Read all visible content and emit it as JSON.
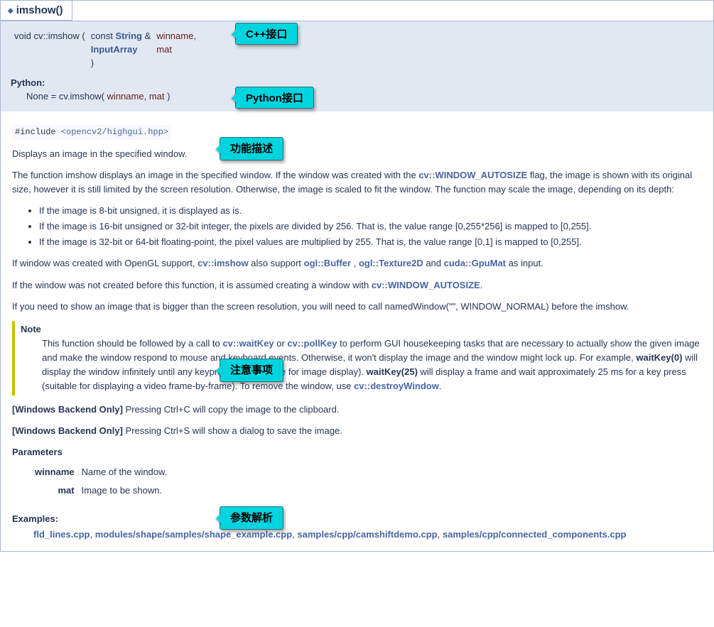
{
  "header": {
    "title": "imshow()"
  },
  "callouts": {
    "cpp": "C++接口",
    "python": "Python接口",
    "desc": "功能描述",
    "note": "注意事项",
    "params": "参数解析"
  },
  "sig": {
    "ret": "void",
    "ns": "cv::imshow",
    "open": "(",
    "row1_type_pre": "const ",
    "row1_type_link": "String",
    "row1_type_post": " & ",
    "row1_name": "winname",
    "row1_end": ",",
    "row2_type": "InputArray",
    "row2_name": "mat",
    "close": ")"
  },
  "python": {
    "label": "Python:",
    "pre": "None = cv.imshow( ",
    "p1": "winname",
    "mid": ", ",
    "p2": "mat",
    "post": " )"
  },
  "include": {
    "pre": "#include ",
    "path": "<opencv2/highgui.hpp>"
  },
  "brief": "Displays an image in the specified window.",
  "para1_a": "The function imshow displays an image in the specified window. If the window was created with the ",
  "para1_link": "cv::WINDOW_AUTOSIZE",
  "para1_b": " flag, the image is shown with its original size, however it is still limited by the screen resolution. Otherwise, the image is scaled to fit the window. The function may scale the image, depending on its depth:",
  "bullets": [
    "If the image is 8-bit unsigned, it is displayed as is.",
    "If the image is 16-bit unsigned or 32-bit integer, the pixels are divided by 256. That is, the value range [0,255*256] is mapped to [0,255].",
    "If the image is 32-bit or 64-bit floating-point, the pixel values are multiplied by 255. That is, the value range [0,1] is mapped to [0,255]."
  ],
  "opengl": {
    "a": "If window was created with OpenGL support, ",
    "l1": "cv::imshow",
    "b": " also support ",
    "l2": "ogl::Buffer",
    "c": " , ",
    "l3": "ogl::Texture2D",
    "d": " and ",
    "l4": "cuda::GpuMat",
    "e": " as input."
  },
  "notcreated": {
    "a": "If the window was not created before this function, it is assumed creating a window with ",
    "l": "cv::WINDOW_AUTOSIZE",
    "b": "."
  },
  "bigger": "If you need to show an image that is bigger than the screen resolution, you will need to call namedWindow(\"\", WINDOW_NORMAL) before the imshow.",
  "note": {
    "title": "Note",
    "a": "This function should be followed by a call to ",
    "l1": "cv::waitKey",
    "b": " or ",
    "l2": "cv::pollKey",
    "c": " to perform GUI housekeeping tasks that are necessary to actually show the given image and make the window respond to mouse and keyboard events. Otherwise, it won't display the image and the window might lock up. For example, ",
    "wb1": "waitKey(0)",
    "d": " will display the window infinitely until any keypress (it is suitable for image display). ",
    "wb2": "waitKey(25)",
    "e": " will display a frame and wait approximately 25 ms for a key press (suitable for displaying a video frame-by-frame). To remove the window, use ",
    "l3": "cv::destroyWindow",
    "f": "."
  },
  "win1": {
    "b": "[Windows Backend Only]",
    "t": " Pressing Ctrl+C will copy the image to the clipboard."
  },
  "win2": {
    "b": "[Windows Backend Only]",
    "t": " Pressing Ctrl+S will show a dialog to save the image."
  },
  "params": {
    "title": "Parameters",
    "rows": [
      {
        "name": "winname",
        "desc": "Name of the window."
      },
      {
        "name": "mat",
        "desc": "Image to be shown."
      }
    ]
  },
  "examples": {
    "title": "Examples:",
    "links": [
      "fld_lines.cpp",
      "modules/shape/samples/shape_example.cpp",
      "samples/cpp/camshiftdemo.cpp",
      "samples/cpp/connected_components.cpp"
    ],
    "sep": ", "
  }
}
